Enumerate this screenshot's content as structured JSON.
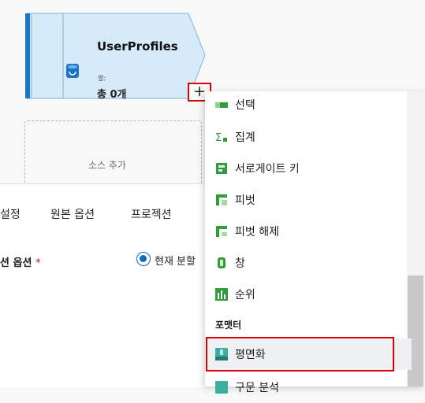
{
  "node": {
    "title": "UserProfiles",
    "sub_label": "열:",
    "count": "총 0개"
  },
  "add_button_label": "+",
  "add_source_label": "소스 추가",
  "panel": {
    "tabs": [
      "설정",
      "원본 옵션",
      "프로젝션"
    ],
    "field_label": "션 옵션",
    "required_mark": "*",
    "radio_label": "현재 분할"
  },
  "menu": {
    "items": [
      {
        "label": "선택",
        "icon": "select-icon"
      },
      {
        "label": "집계",
        "icon": "aggregate-icon"
      },
      {
        "label": "서로게이트 키",
        "icon": "surrogate-key-icon"
      },
      {
        "label": "피벗",
        "icon": "pivot-icon"
      },
      {
        "label": "피벗 해제",
        "icon": "unpivot-icon"
      },
      {
        "label": "창",
        "icon": "window-icon"
      },
      {
        "label": "순위",
        "icon": "rank-icon"
      }
    ],
    "section_header": "포맷터",
    "selected_item": {
      "label": "평면화",
      "icon": "flatten-icon"
    },
    "partial_item": {
      "label": "구문 분석",
      "icon": "parse-icon"
    }
  },
  "colors": {
    "node_fill": "#d6ebfa",
    "node_accent": "#1a74c8",
    "highlight_red": "#e00000",
    "icon_green": "#2e9e3a"
  }
}
